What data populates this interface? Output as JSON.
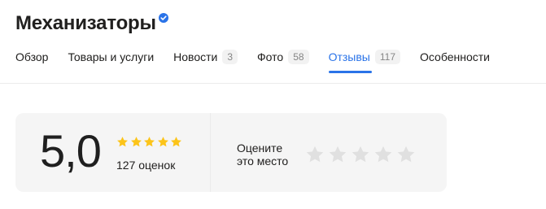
{
  "header": {
    "title": "Механизаторы",
    "verified_icon": "verified-check-icon"
  },
  "tabs": [
    {
      "label": "Обзор",
      "count": null,
      "active": false
    },
    {
      "label": "Товары и услуги",
      "count": null,
      "active": false
    },
    {
      "label": "Новости",
      "count": "3",
      "active": false
    },
    {
      "label": "Фото",
      "count": "58",
      "active": false
    },
    {
      "label": "Отзывы",
      "count": "117",
      "active": true
    },
    {
      "label": "Особенности",
      "count": null,
      "active": false
    }
  ],
  "rating": {
    "value": "5,0",
    "stars_filled": 5,
    "stars_total": 5,
    "count_text": "127 оценок"
  },
  "rate": {
    "line1": "Оцените",
    "line2": "это место",
    "stars_total": 5
  },
  "colors": {
    "accent": "#2a73e8",
    "star_gold": "#fcc419",
    "star_empty": "#e0e0e0",
    "card_bg": "#f5f5f5"
  }
}
